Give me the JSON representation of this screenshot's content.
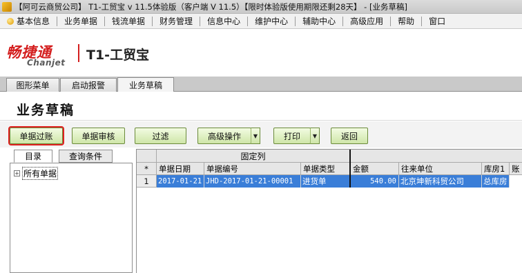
{
  "window": {
    "title": "【阿可云商贸公司】 T1-工贸宝 v 11.5体验版（客户端 V 11.5）【限时体验版使用期限还剩28天】 - [业务草稿]"
  },
  "menu": {
    "items": [
      {
        "label": "基本信息"
      },
      {
        "label": "业务单据"
      },
      {
        "label": "钱流单据"
      },
      {
        "label": "财务管理"
      },
      {
        "label": "信息中心"
      },
      {
        "label": "维护中心"
      },
      {
        "label": "辅助中心"
      },
      {
        "label": "高级应用"
      },
      {
        "label": "帮助"
      },
      {
        "label": "窗口"
      }
    ]
  },
  "brand": {
    "logo_cn": "畅捷通",
    "logo_en": "Chanjet",
    "product": "T1-工贸宝",
    "brand_color": "#d41e1e"
  },
  "tabs": [
    {
      "label": "图形菜单",
      "active": false
    },
    {
      "label": "启动报警",
      "active": false
    },
    {
      "label": "业务草稿",
      "active": true
    }
  ],
  "page": {
    "title": "业务草稿"
  },
  "toolbar": {
    "post": "单据过账",
    "audit": "单据审核",
    "filter": "过滤",
    "advanced": "高级操作",
    "print": "打印",
    "back": "返回"
  },
  "left_panel": {
    "tabs": [
      "目录",
      "查询条件"
    ],
    "tree": {
      "expander": "+",
      "root": "所有单据"
    }
  },
  "grid": {
    "group_header": "固定列",
    "row_marker": "*",
    "columns": [
      "单据日期",
      "单据编号",
      "单据类型",
      "金额",
      "往来单位",
      "库房1",
      "账"
    ],
    "rows": [
      {
        "index": "1",
        "date": "2017-01-21",
        "number": "JHD-2017-01-21-00001",
        "type": "进货单",
        "amount": "540.00",
        "partner": "北京坤新科贸公司",
        "warehouse": "总库房"
      }
    ],
    "selection_color": "#3a7ed8"
  }
}
